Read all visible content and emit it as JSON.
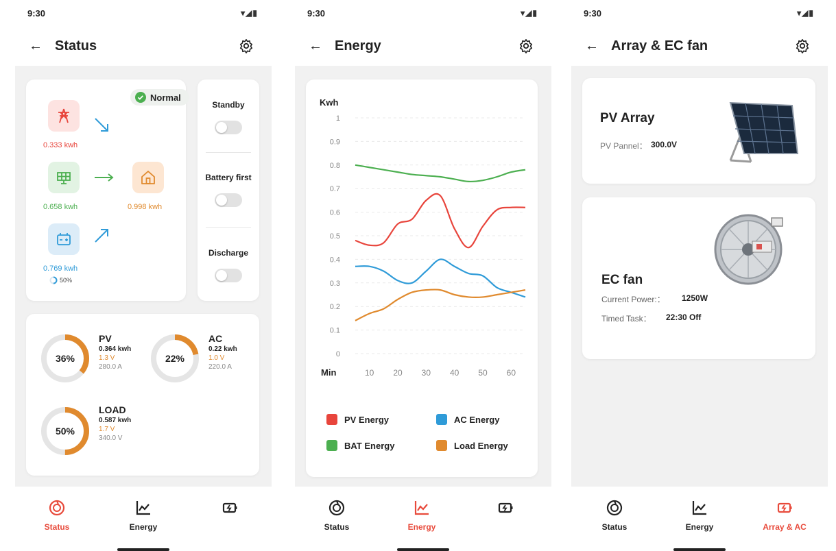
{
  "status_bar": {
    "time": "9:30",
    "icons": "wifi-icon signal-icon battery-icon"
  },
  "screens": {
    "status": {
      "title": "Status",
      "badge": "Normal",
      "grid_value": "0.333 kwh",
      "pv_value": "0.658 kwh",
      "battery_value": "0.769 kwh",
      "battery_pct": "50%",
      "home_value": "0.998 kwh",
      "toggles": [
        {
          "label": "Standby",
          "on": false
        },
        {
          "label": "Battery first",
          "on": false
        },
        {
          "label": "Discharge",
          "on": false
        }
      ],
      "metrics": [
        {
          "name": "PV",
          "pct": "36%",
          "fraction": 0.36,
          "kwh": "0.364 kwh",
          "volt": "1.3 V",
          "extra": "280.0 A"
        },
        {
          "name": "AC",
          "pct": "22%",
          "fraction": 0.22,
          "kwh": "0.22 kwh",
          "volt": "1.0 V",
          "extra": "220.0 A"
        },
        {
          "name": "LOAD",
          "pct": "50%",
          "fraction": 0.5,
          "kwh": "0.587 kwh",
          "volt": "1.7 V",
          "extra": "340.0 V"
        }
      ]
    },
    "energy": {
      "title": "Energy"
    },
    "array": {
      "title": "Array & EC fan",
      "pv_title": "PV Array",
      "pv_label": "PV Pannel：",
      "pv_value": "300.0V",
      "fan_title": "EC fan",
      "fan_power_label": "Current Power:：",
      "fan_power_value": "1250W",
      "fan_task_label": "Timed Task：",
      "fan_task_value": "22:30 Off"
    }
  },
  "nav": {
    "status": "Status",
    "energy": "Energy",
    "array": "Array & AC"
  },
  "colors": {
    "accent": "#e84a3b",
    "orange": "#e08a2e",
    "green": "#4caf50",
    "blue": "#2f9bd8"
  },
  "chart_data": {
    "type": "line",
    "ylabel": "Kwh",
    "xlabel": "Min",
    "ylim": [
      0,
      1
    ],
    "xlim": [
      5,
      65
    ],
    "yticks": [
      "0",
      "0.1",
      "0.2",
      "0.3",
      "0.4",
      "0.5",
      "0.6",
      "0.7",
      "0.8",
      "0.9",
      "1"
    ],
    "xticks": [
      "10",
      "20",
      "30",
      "40",
      "50",
      "60"
    ],
    "grid": true,
    "legend_position": "bottom",
    "series": [
      {
        "name": "PV Energy",
        "color": "#e8453c",
        "x": [
          5,
          10,
          15,
          20,
          25,
          30,
          35,
          40,
          45,
          50,
          55,
          60,
          65
        ],
        "y": [
          0.48,
          0.46,
          0.47,
          0.55,
          0.57,
          0.65,
          0.67,
          0.53,
          0.45,
          0.54,
          0.61,
          0.62,
          0.62
        ]
      },
      {
        "name": "AC Energy",
        "color": "#2f9bd8",
        "x": [
          5,
          10,
          15,
          20,
          25,
          30,
          35,
          40,
          45,
          50,
          55,
          60,
          65
        ],
        "y": [
          0.37,
          0.37,
          0.35,
          0.31,
          0.3,
          0.35,
          0.4,
          0.37,
          0.34,
          0.33,
          0.28,
          0.26,
          0.24
        ]
      },
      {
        "name": "BAT Energy",
        "color": "#4caf50",
        "x": [
          5,
          10,
          15,
          20,
          25,
          30,
          35,
          40,
          45,
          50,
          55,
          60,
          65
        ],
        "y": [
          0.8,
          0.79,
          0.78,
          0.77,
          0.76,
          0.755,
          0.75,
          0.74,
          0.73,
          0.735,
          0.75,
          0.77,
          0.78
        ]
      },
      {
        "name": "Load Energy",
        "color": "#e08a2e",
        "x": [
          5,
          10,
          15,
          20,
          25,
          30,
          35,
          40,
          45,
          50,
          55,
          60,
          65
        ],
        "y": [
          0.14,
          0.17,
          0.19,
          0.23,
          0.26,
          0.27,
          0.27,
          0.25,
          0.24,
          0.24,
          0.25,
          0.26,
          0.27
        ]
      }
    ]
  }
}
